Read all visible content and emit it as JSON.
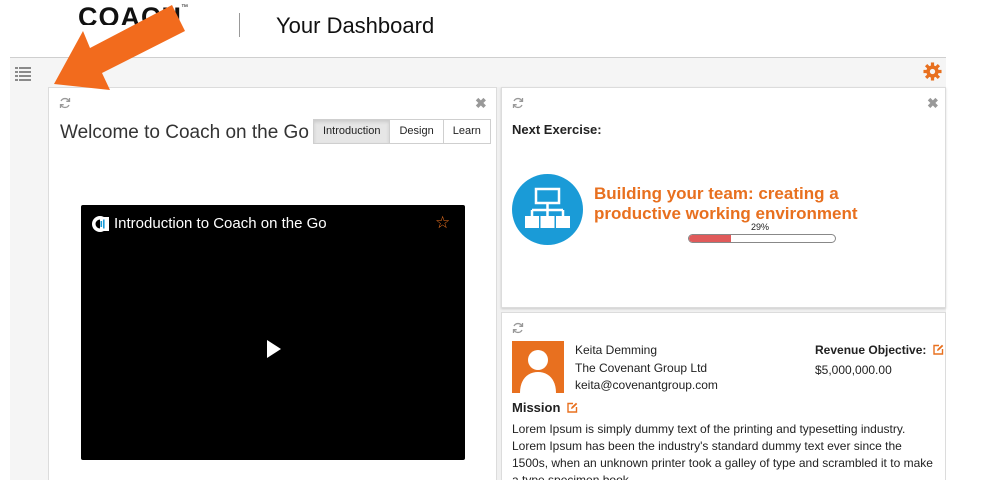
{
  "header": {
    "logo_text": "COACH",
    "logo_mark": "™",
    "title": "Your Dashboard"
  },
  "toolbar": {
    "menu_icon": "list-icon",
    "settings_icon": "gear-icon"
  },
  "welcome_panel": {
    "title": "Welcome to Coach on the Go",
    "tabs": [
      {
        "label": "Introduction",
        "active": true
      },
      {
        "label": "Design",
        "active": false
      },
      {
        "label": "Learn",
        "active": false
      }
    ],
    "video": {
      "title": "Introduction to Coach on the Go"
    }
  },
  "exercise_panel": {
    "label": "Next Exercise:",
    "title": "Building your team: creating a productive working environment",
    "progress_percent": 29,
    "progress_label": "29%",
    "accent_color": "#e8701f",
    "icon_color": "#1a9bd7"
  },
  "profile_panel": {
    "name": "Keita Demming",
    "company": "The Covenant Group Ltd",
    "email": "keita@covenantgroup.com",
    "revenue_label": "Revenue Objective:",
    "revenue_value": "$5,000,000.00",
    "mission_label": "Mission",
    "mission_text": "Lorem Ipsum is simply dummy text of the printing and typesetting industry. Lorem Ipsum has been the industry's standard dummy text ever since the 1500s, when an unknown printer took a galley of type and scrambled it to make a type specimen book."
  }
}
